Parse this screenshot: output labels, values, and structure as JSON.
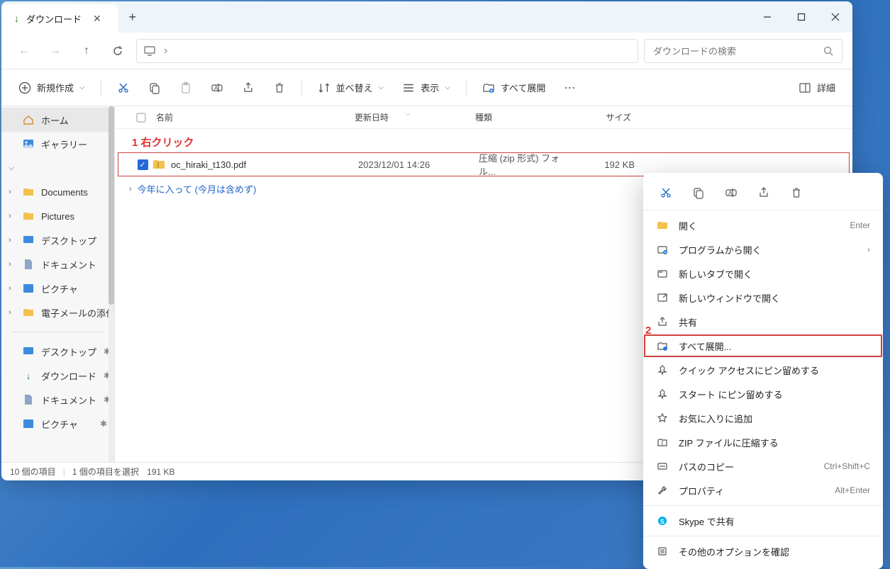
{
  "tab": {
    "title": "ダウンロード"
  },
  "search": {
    "placeholder": "ダウンロードの検索"
  },
  "toolbar": {
    "new": "新規作成",
    "sort": "並べ替え",
    "view": "表示",
    "extract_all": "すべて展開",
    "details": "詳細"
  },
  "columns": {
    "name": "名前",
    "date": "更新日時",
    "type": "種類",
    "size": "サイズ"
  },
  "annotation1": "1 右クリック",
  "annotation2": "2",
  "file": {
    "name": "oc_hiraki_t130.pdf",
    "date": "2023/12/01 14:26",
    "type": "圧縮 (zip 形式) フォル...",
    "size": "192 KB"
  },
  "group": "今年に入って (今月は含めず)",
  "sidebar": {
    "home": "ホーム",
    "gallery": "ギャラリー",
    "documents": "Documents",
    "pictures": "Pictures",
    "desktop_jp": "デスクトップ",
    "document_jp": "ドキュメント",
    "picture_jp": "ピクチャ",
    "email": "電子メールの添付",
    "qa_desktop": "デスクトップ",
    "qa_download": "ダウンロード",
    "qa_document": "ドキュメント",
    "qa_picture": "ピクチャ"
  },
  "status": {
    "items": "10 個の項目",
    "selected": "1 個の項目を選択",
    "size": "191 KB"
  },
  "context": {
    "open": "開く",
    "open_shortcut": "Enter",
    "open_with": "プログラムから開く",
    "open_tab": "新しいタブで開く",
    "open_window": "新しいウィンドウで開く",
    "share": "共有",
    "extract_all": "すべて展開...",
    "pin_quick": "クイック アクセスにピン留めする",
    "pin_start": "スタート にピン留めする",
    "favorite": "お気に入りに追加",
    "compress": "ZIP ファイルに圧縮する",
    "copy_path": "パスのコピー",
    "copy_path_shortcut": "Ctrl+Shift+C",
    "properties": "プロパティ",
    "properties_shortcut": "Alt+Enter",
    "skype": "Skype で共有",
    "more": "その他のオプションを確認"
  }
}
